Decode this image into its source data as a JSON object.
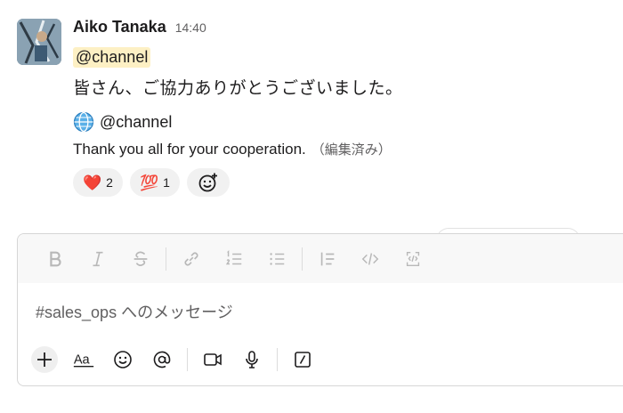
{
  "message": {
    "author": "Aiko Tanaka",
    "time": "14:40",
    "mention": "@channel",
    "text_jp": "皆さん、ご協力ありがとうございました。",
    "translation": {
      "icon": "globe-icon",
      "mention": "@channel",
      "text_en": "Thank you all for your cooperation.",
      "edited_label": "（編集済み）"
    },
    "reactions": [
      {
        "emoji": "❤️",
        "icon": "heart-icon",
        "count": "2"
      },
      {
        "emoji": "💯",
        "icon": "hundred-points-icon",
        "count": "1"
      }
    ]
  },
  "composer": {
    "placeholder": "#sales_ops へのメッセージ",
    "format_buttons": [
      "bold",
      "italic",
      "strikethrough",
      "link",
      "ordered-list",
      "bulleted-list",
      "blockquote",
      "code",
      "code-block"
    ],
    "bottom_buttons": [
      "add",
      "formatting",
      "emoji",
      "mention",
      "video",
      "audio",
      "slash-command"
    ]
  },
  "colors": {
    "mention_bg": "#fdf0c4",
    "reaction_bg": "#f1f1f1",
    "muted_text": "#616061"
  }
}
